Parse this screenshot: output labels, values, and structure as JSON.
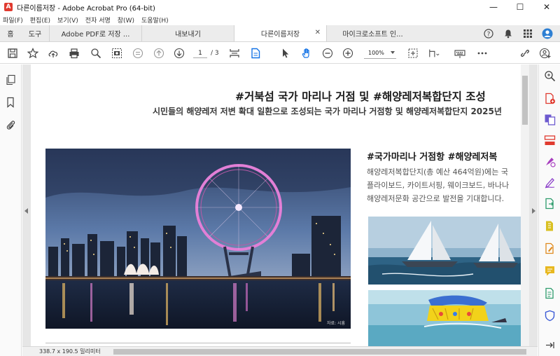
{
  "window": {
    "title": "다른이름저장 - Adobe Acrobat Pro (64-bit)",
    "minimize": "—",
    "maximize": "☐",
    "close": "✕"
  },
  "menu": [
    "파일(F)",
    "편집(E)",
    "보기(V)",
    "전자 서명",
    "창(W)",
    "도움말(H)"
  ],
  "tabs": {
    "home": "홈",
    "tools": "도구",
    "docs": [
      {
        "label": "Adobe PDF로 저장 ...",
        "active": false
      },
      {
        "label": "내보내기",
        "active": false
      },
      {
        "label": "다른이름저장",
        "active": true
      },
      {
        "label": "마이크로소프트 인...",
        "active": false
      }
    ],
    "close_glyph": "✕"
  },
  "toolbar": {
    "page_current": "1",
    "page_total": "/ 3",
    "zoom": "100%"
  },
  "document": {
    "heading": "#거북섬 국가 마리나 거점 및 #해양레저복합단지 조성",
    "subheading": "시민들의 해양레저 저변 확대 일환으로 조성되는 국가 마리나 거점항 및 해양레저복합단지 2025년",
    "sub_title": "#국가마리나 거점항  #해양레저복",
    "paragraph": [
      "해양레저복합단지(총 예산 464억원)에는 국",
      "플라이보드, 카이트서핑, 웨이크보드, 바나나",
      "해양레저문화 공간으로 발전을 기대합니다."
    ],
    "photo_caption": "자료: 시흥"
  },
  "status": {
    "dimensions": "338.7 x 190.5 밀리미터"
  },
  "colors": {
    "accent_blue": "#1473e6",
    "acrobat_red": "#e03a2f"
  }
}
